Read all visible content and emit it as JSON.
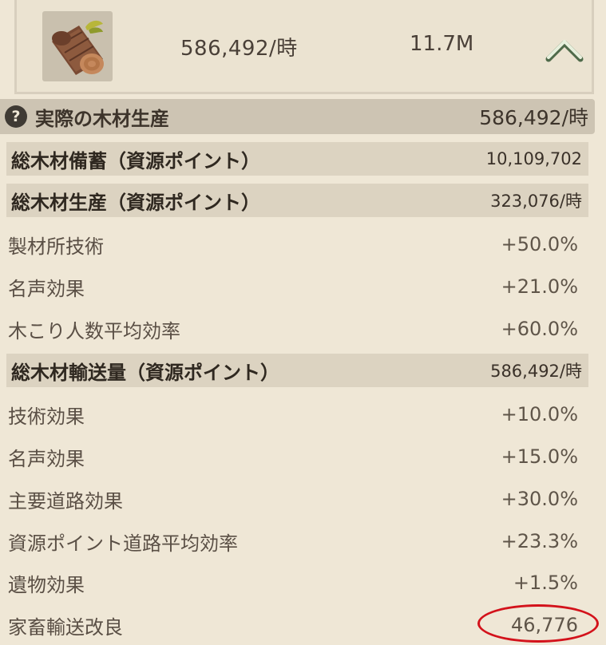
{
  "header": {
    "icon_name": "wood-log-icon",
    "rate": "586,492/時",
    "total": "11.7M",
    "collapse_icon": "chevron-up-icon"
  },
  "summary": {
    "label": "実際の木材生産",
    "value": "586,492/時",
    "help_icon": "question-mark-icon"
  },
  "rows": [
    {
      "label": "総木材備蓄（資源ポイント）",
      "value": "10,109,702"
    },
    {
      "label": "総木材生産（資源ポイント）",
      "value": "323,076/時"
    },
    {
      "label": "製材所技術",
      "value": "+50.0%"
    },
    {
      "label": "名声効果",
      "value": "+21.0%"
    },
    {
      "label": "木こり人数平均効率",
      "value": "+60.0%"
    },
    {
      "label": "総木材輸送量（資源ポイント）",
      "value": "586,492/時"
    },
    {
      "label": "技術効果",
      "value": "+10.0%"
    },
    {
      "label": "名声効果",
      "value": "+15.0%"
    },
    {
      "label": "主要道路効果",
      "value": "+30.0%"
    },
    {
      "label": "資源ポイント道路平均効率",
      "value": "+23.3%"
    },
    {
      "label": "遺物効果",
      "value": "+1.5%"
    },
    {
      "label": "家畜輸送改良",
      "value": "46,776"
    }
  ],
  "colors": {
    "background": "#efe7d6",
    "main_bar": "#cdc4b3",
    "section_bar": "#dcd3c1",
    "highlight_circle": "#d3121b"
  }
}
